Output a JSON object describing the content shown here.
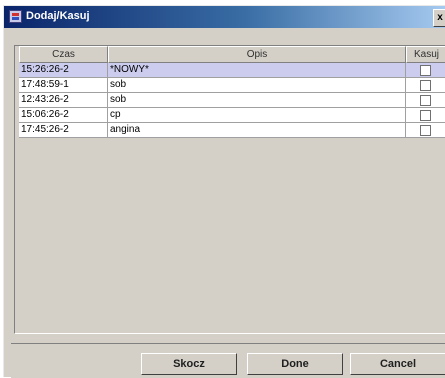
{
  "window": {
    "title": "Dodaj/Kasuj",
    "close_label": "x"
  },
  "table": {
    "columns": [
      "Czas",
      "Opis",
      "Kasuj"
    ],
    "rows": [
      {
        "time": "15:26:26-2",
        "desc": "*NOWY*",
        "delete": false,
        "selected": true
      },
      {
        "time": "17:48:59-1",
        "desc": "sob",
        "delete": false,
        "selected": false
      },
      {
        "time": "12:43:26-2",
        "desc": "sob",
        "delete": false,
        "selected": false
      },
      {
        "time": "15:06:26-2",
        "desc": "cp",
        "delete": false,
        "selected": false
      },
      {
        "time": "17:45:26-2",
        "desc": "angina",
        "delete": false,
        "selected": false
      }
    ]
  },
  "buttons": {
    "skocz": "Skocz",
    "done": "Done",
    "cancel": "Cancel"
  }
}
